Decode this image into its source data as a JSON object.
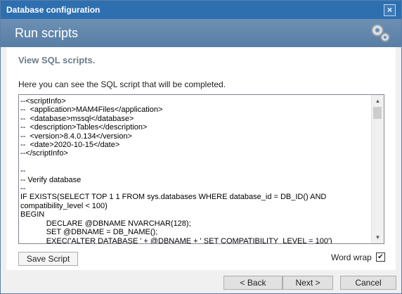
{
  "window": {
    "title": "Database configuration"
  },
  "banner": {
    "heading": "Run scripts"
  },
  "main": {
    "subtitle": "View SQL scripts.",
    "description": "Here you can see the SQL script that will be completed.",
    "script": "--<scriptInfo>\n--  <application>MAM4Files</application>\n--  <database>mssql</database>\n--  <description>Tables</description>\n--  <version>8.4.0.134</version>\n--  <date>2020-10-15</date>\n--</scriptInfo>\n\n--\n-- Verify database\n--\nIF EXISTS(SELECT TOP 1 1 FROM sys.databases WHERE database_id = DB_ID() AND compatibility_level < 100)\nBEGIN\n            DECLARE @DBNAME NVARCHAR(128);\n            SET @DBNAME = DB_NAME();\n            EXEC('ALTER DATABASE ' + @DBNAME + ' SET COMPATIBILITY_LEVEL = 100')"
  },
  "controls": {
    "save_label": "Save Script",
    "wordwrap_label": "Word wrap",
    "wordwrap_checked": "✔"
  },
  "footer": {
    "back_label": "< Back",
    "next_label": "Next >",
    "cancel_label": "Cancel"
  }
}
